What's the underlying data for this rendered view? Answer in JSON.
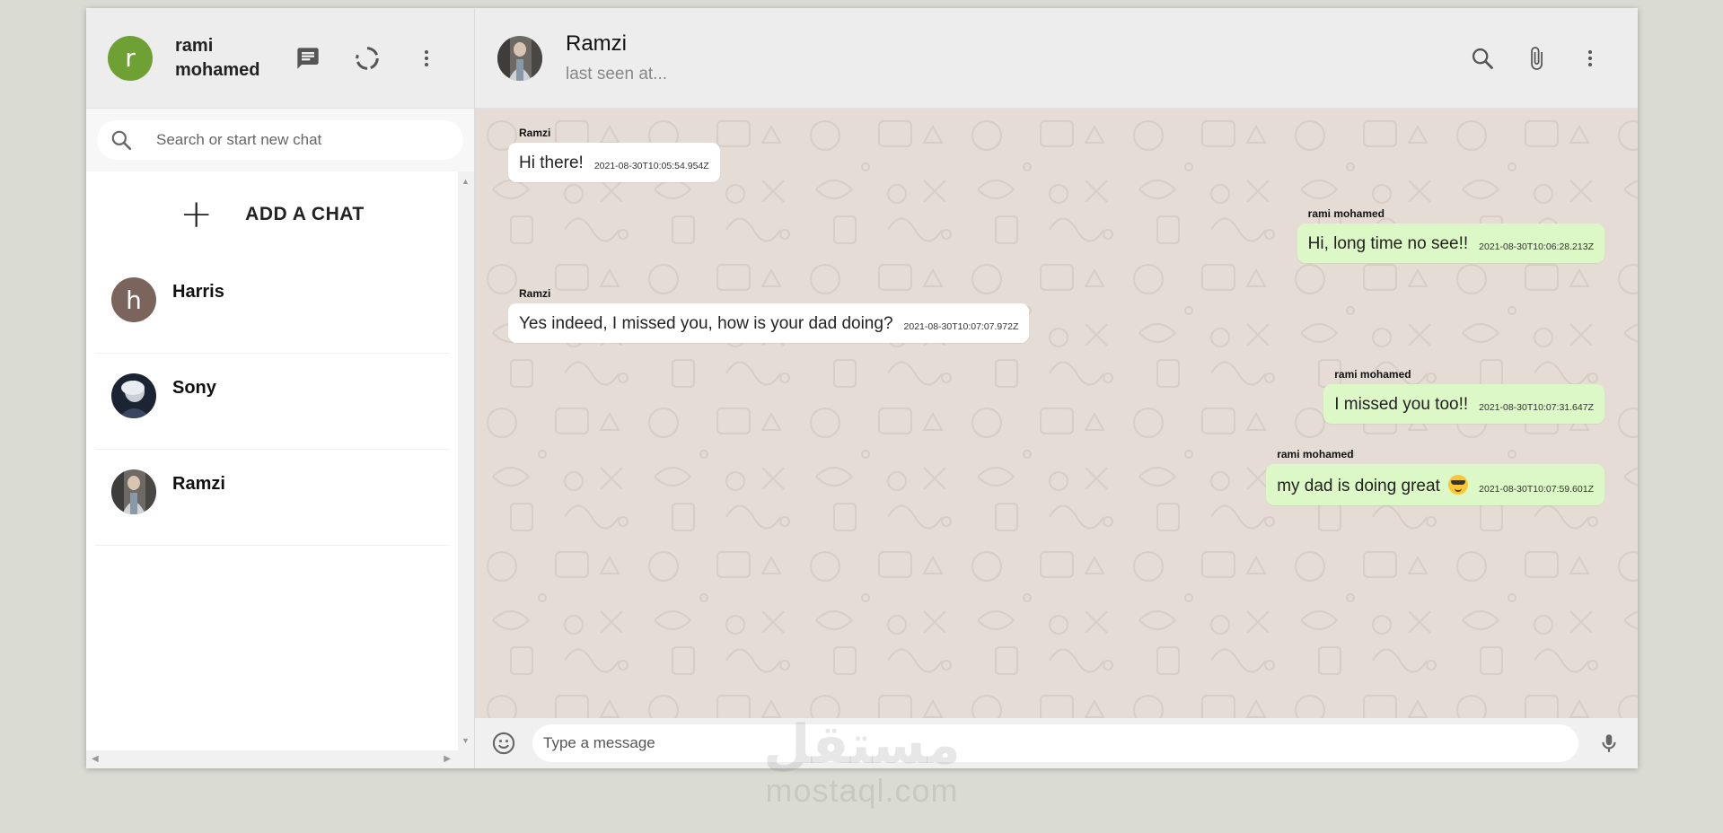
{
  "me": {
    "initial": "r",
    "name": "rami mohamed",
    "avatar_color": "#6ea034"
  },
  "sidebar_icons": [
    "chat-icon",
    "status-icon",
    "more-vert-icon"
  ],
  "search": {
    "placeholder": "Search or start new chat"
  },
  "add_chat": {
    "icon": "+",
    "label": "ADD A CHAT"
  },
  "chats": [
    {
      "name": "Harris",
      "initial": "h",
      "avatar_color": "#7b645c"
    },
    {
      "name": "Sony"
    },
    {
      "name": "Ramzi"
    }
  ],
  "active_chat": {
    "name": "Ramzi",
    "status": "last seen at..."
  },
  "messages": [
    {
      "sender": "Ramzi",
      "text": "Hi there!",
      "time": "2021-08-30T10:05:54.954Z",
      "direction": "in"
    },
    {
      "sender": "rami mohamed",
      "text": "Hi, long time no see!!",
      "time": "2021-08-30T10:06:28.213Z",
      "direction": "out"
    },
    {
      "sender": "Ramzi",
      "text": "Yes indeed, I missed you, how is your dad doing?",
      "time": "2021-08-30T10:07:07.972Z",
      "direction": "in"
    },
    {
      "sender": "rami mohamed",
      "text": "I missed you too!!",
      "time": "2021-08-30T10:07:31.647Z",
      "direction": "out"
    },
    {
      "sender": "rami mohamed",
      "text": "my dad is doing great",
      "emoji": "sunglasses-emoji",
      "time": "2021-08-30T10:07:59.601Z",
      "direction": "out"
    }
  ],
  "composer": {
    "placeholder": "Type a message"
  },
  "colors": {
    "outgoing_bubble": "#dcf8c6",
    "incoming_bubble": "#ffffff",
    "chat_background": "#e5ddd5",
    "header": "#ededed"
  },
  "watermark": {
    "arabic": "مستقل",
    "latin": "mostaql.com"
  }
}
